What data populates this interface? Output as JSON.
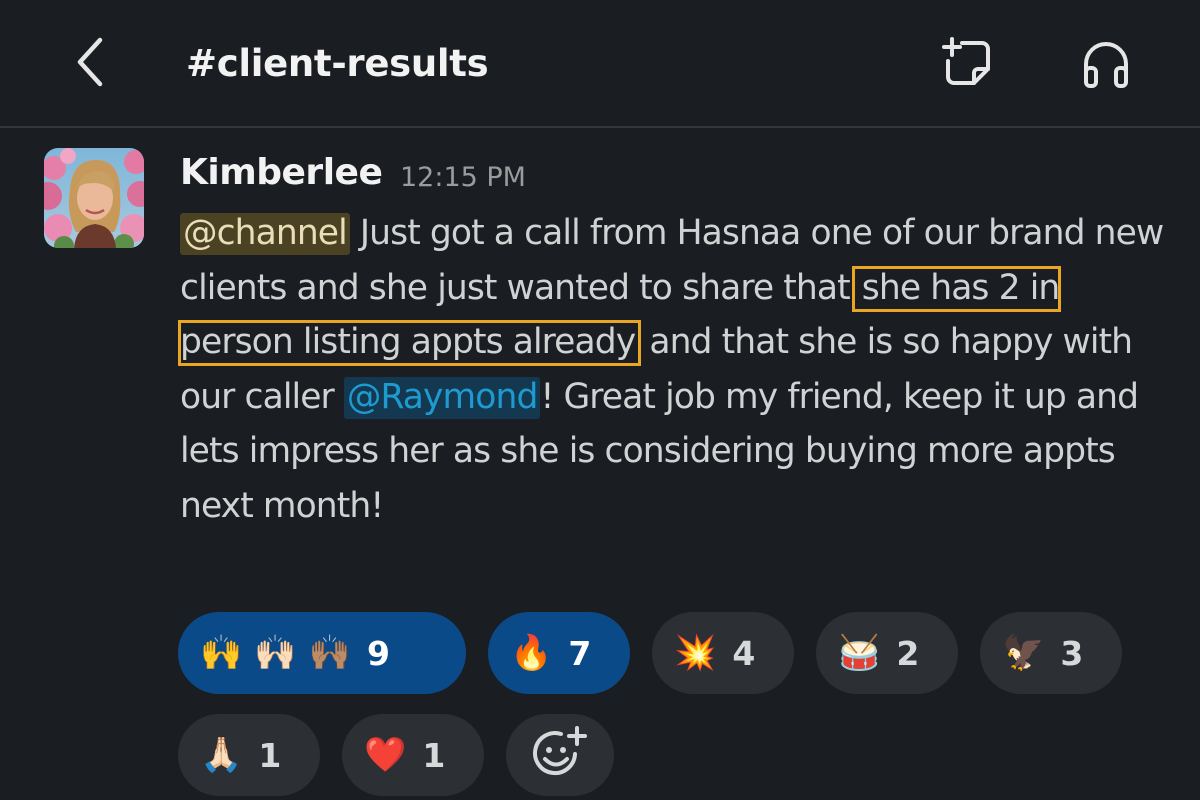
{
  "header": {
    "channel_name": "#client-results",
    "back_icon": "chevron-left-icon",
    "canvas_icon": "new-canvas-icon",
    "huddle_icon": "headphones-icon"
  },
  "message": {
    "author": "Kimberlee",
    "timestamp": "12:15 PM",
    "mention_channel": "@channel",
    "text_part1": " Just got a call from Hasnaa one of our brand new clients and she just wanted to share that ",
    "highlighted_text": "she has 2 in person listing appts already",
    "text_part2": " and that she is so happy with our caller ",
    "mention_user": "@Raymond",
    "text_part3": "! Great job my friend, keep it up and lets impress her as she is considering buying more appts next month!"
  },
  "reactions": [
    {
      "emoji": [
        "🙌",
        "🙌🏻",
        "🙌🏽"
      ],
      "count": "9",
      "active": true
    },
    {
      "emoji": [
        "🔥"
      ],
      "count": "7",
      "active": true
    },
    {
      "emoji": [
        "💥"
      ],
      "count": "4",
      "active": false
    },
    {
      "emoji": [
        "🥁"
      ],
      "count": "2",
      "active": false
    },
    {
      "emoji": [
        "🦅"
      ],
      "count": "3",
      "active": false
    },
    {
      "emoji": [
        "🙏🏻"
      ],
      "count": "1",
      "active": false
    },
    {
      "emoji": [
        "❤️"
      ],
      "count": "1",
      "active": false
    }
  ],
  "add_reaction_icon": "add-emoji-icon",
  "colors": {
    "background": "#1a1d21",
    "active_reaction": "#0b4a88",
    "inactive_reaction": "#2c2f34",
    "highlight_box": "#e8a623",
    "user_mention": "#1d9bd1",
    "channel_mention_bg": "#4a4222"
  }
}
